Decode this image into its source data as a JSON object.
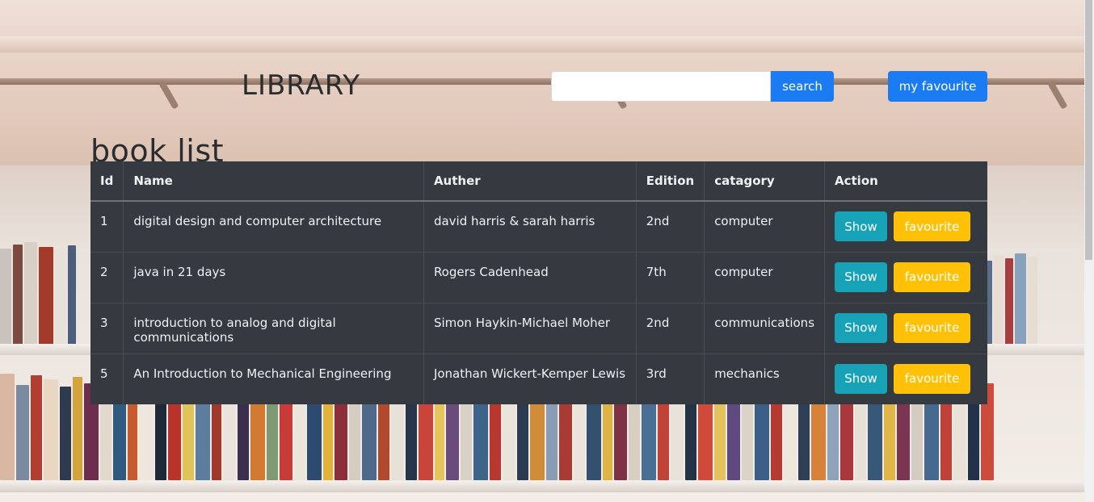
{
  "header": {
    "brand": "LIBRARY",
    "search": {
      "value": "",
      "placeholder": "",
      "button_label": "search"
    },
    "favourites_button_label": "my favourite"
  },
  "page_title": "book list",
  "table": {
    "columns": [
      "Id",
      "Name",
      "Auther",
      "Edition",
      "catagory",
      "Action"
    ],
    "rows": [
      {
        "id": "1",
        "name": "digital design and computer architecture",
        "author": "david harris & sarah harris",
        "edition": "2nd",
        "category": "computer"
      },
      {
        "id": "2",
        "name": "java in 21 days",
        "author": "Rogers Cadenhead",
        "edition": "7th",
        "category": "computer"
      },
      {
        "id": "3",
        "name": "introduction to analog and digital communications",
        "author": "Simon Haykin-Michael Moher",
        "edition": "2nd",
        "category": "communications"
      },
      {
        "id": "5",
        "name": "An Introduction to Mechanical Engineering",
        "author": "Jonathan Wickert-Kemper Lewis",
        "edition": "3rd",
        "category": "mechanics"
      }
    ],
    "actions": {
      "show_label": "Show",
      "favourite_label": "favourite"
    }
  },
  "colors": {
    "primary": "#1a7bf2",
    "info": "#17a2b8",
    "warning": "#ffc107",
    "table_bg": "#343a40"
  }
}
